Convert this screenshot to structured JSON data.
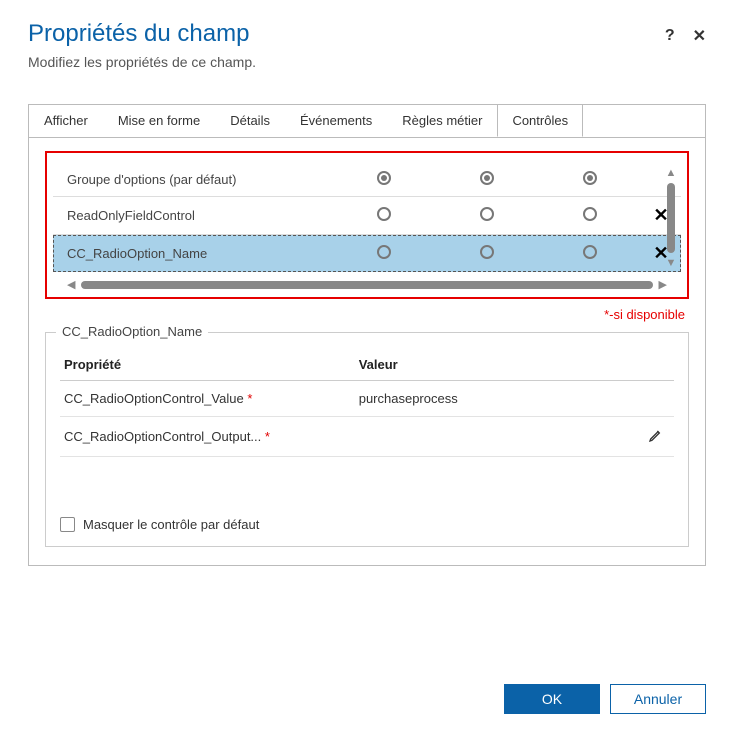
{
  "header": {
    "title": "Propriétés du champ",
    "subtitle": "Modifiez les propriétés de ce champ."
  },
  "tabs": {
    "t0": "Afficher",
    "t1": "Mise en forme",
    "t2": "Détails",
    "t3": "Événements",
    "t4": "Règles métier",
    "t5": "Contrôles"
  },
  "controls": {
    "row0": {
      "label": "Groupe d'options (par défaut)"
    },
    "row1": {
      "label": "ReadOnlyFieldControl"
    },
    "row2": {
      "label": "CC_RadioOption_Name"
    }
  },
  "note": "*-si disponible",
  "fieldset": {
    "legend": "CC_RadioOption_Name",
    "col_prop": "Propriété",
    "col_val": "Valeur",
    "prop0": {
      "name": "CC_RadioOptionControl_Value",
      "value": "purchaseprocess"
    },
    "prop1": {
      "name": "CC_RadioOptionControl_Output...",
      "value": ""
    },
    "hide_label": "Masquer le contrôle par défaut"
  },
  "footer": {
    "ok": "OK",
    "cancel": "Annuler"
  }
}
